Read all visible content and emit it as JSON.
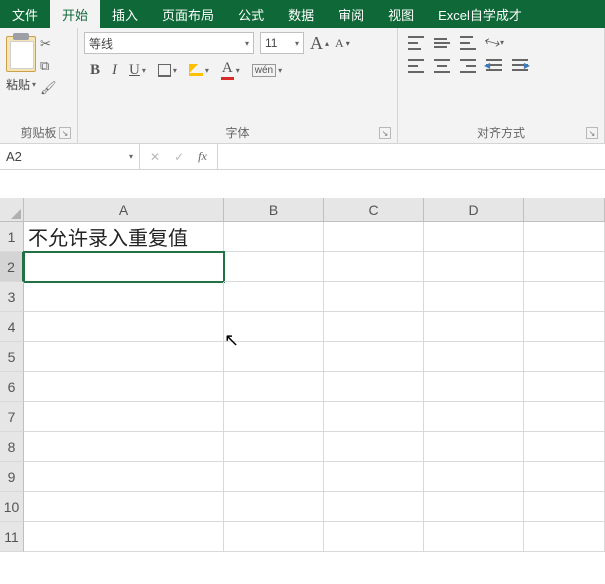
{
  "tabs": [
    "文件",
    "开始",
    "插入",
    "页面布局",
    "公式",
    "数据",
    "审阅",
    "视图",
    "Excel自学成才"
  ],
  "active_tab_index": 1,
  "clipboard": {
    "paste": "粘贴",
    "group": "剪贴板"
  },
  "font": {
    "name": "等线",
    "size": "11",
    "bold": "B",
    "italic": "I",
    "underline": "U",
    "font_color_letter": "A",
    "phonetic": "wén",
    "group": "字体",
    "grow": "A",
    "shrink": "A"
  },
  "align": {
    "group": "对齐方式",
    "orientation_glyph": "⤢"
  },
  "namebox": "A2",
  "fx_label": "fx",
  "columns": [
    "A",
    "B",
    "C",
    "D"
  ],
  "rows": [
    "1",
    "2",
    "3",
    "4",
    "5",
    "6",
    "7",
    "8",
    "9",
    "10",
    "11"
  ],
  "cells": {
    "A1": "不允许录入重复值"
  },
  "selected_cell": "A2"
}
